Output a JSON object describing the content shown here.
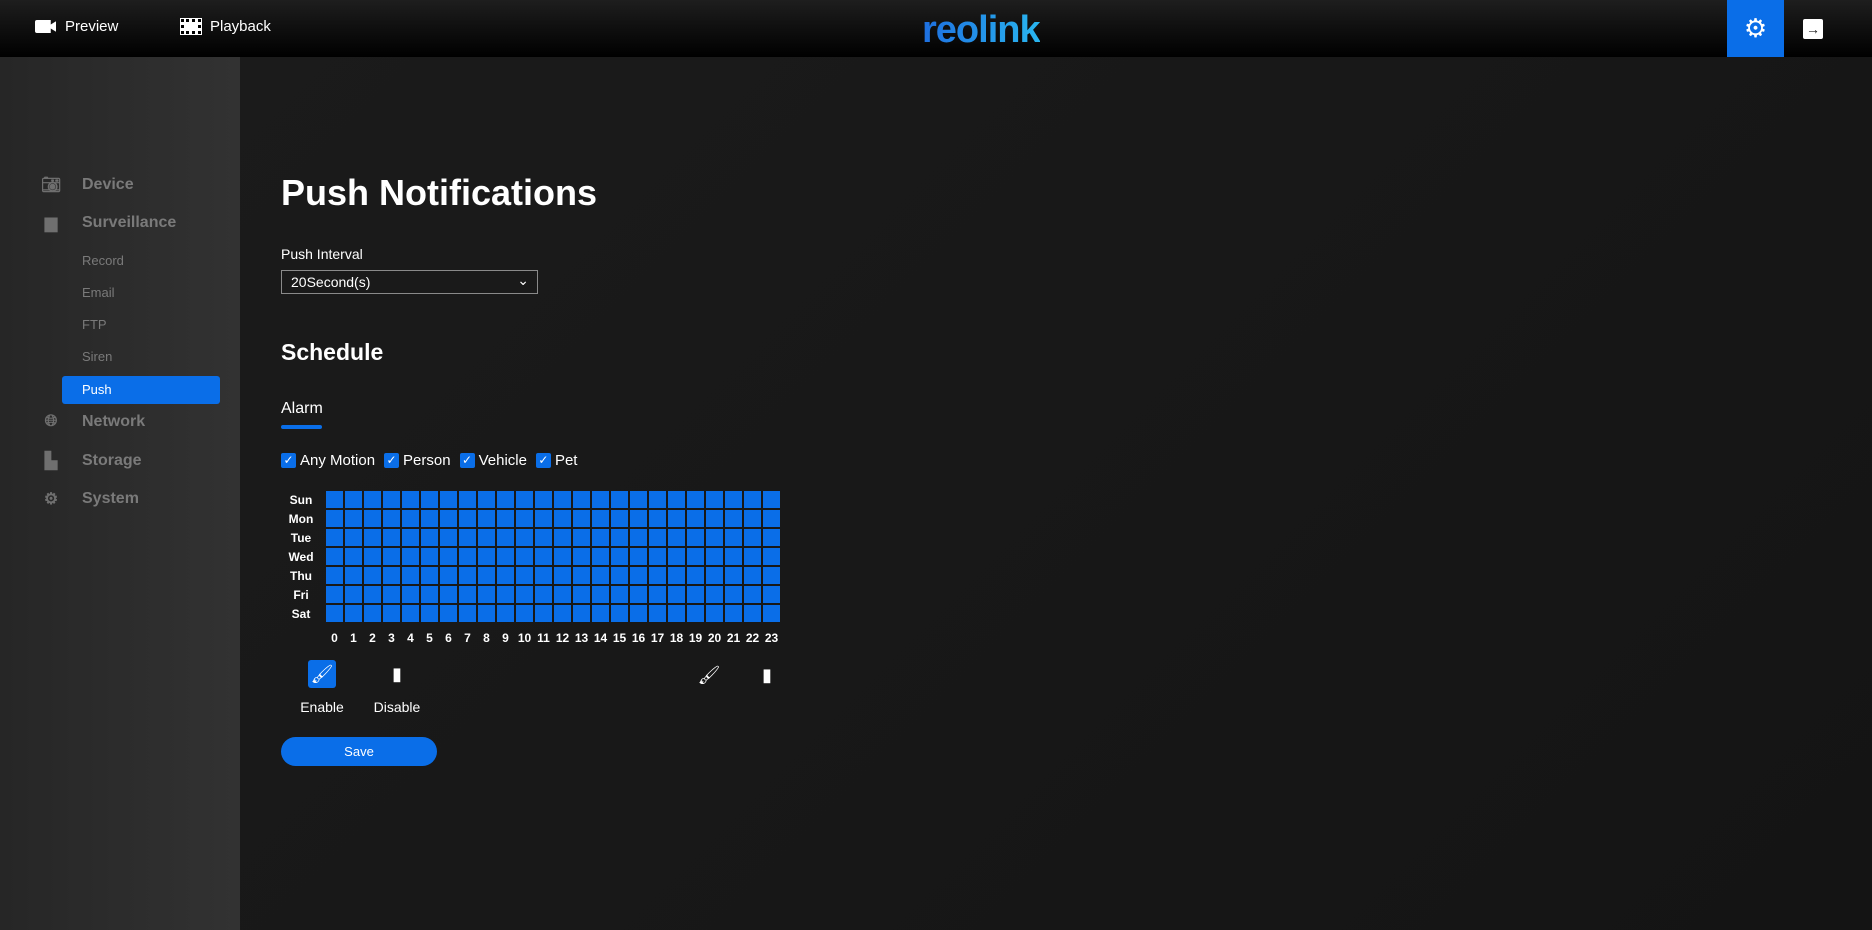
{
  "header": {
    "preview_label": "Preview",
    "playback_label": "Playback",
    "logo": "reolink",
    "accent": "#0a6ee8"
  },
  "sidebar": {
    "device": "Device",
    "surveillance": "Surveillance",
    "sub_items": [
      "Record",
      "Email",
      "FTP",
      "Siren",
      "Push"
    ],
    "active": "Push",
    "network": "Network",
    "storage": "Storage",
    "system": "System"
  },
  "main": {
    "title": "Push Notifications",
    "push_interval_label": "Push Interval",
    "push_interval_value": "20Second(s)",
    "schedule_title": "Schedule",
    "tab": "Alarm",
    "checkboxes": [
      {
        "label": "Any Motion",
        "checked": true
      },
      {
        "label": "Person",
        "checked": true
      },
      {
        "label": "Vehicle",
        "checked": true
      },
      {
        "label": "Pet",
        "checked": true
      }
    ],
    "days": [
      "Sun",
      "Mon",
      "Tue",
      "Wed",
      "Thu",
      "Fri",
      "Sat"
    ],
    "hours": [
      "0",
      "1",
      "2",
      "3",
      "4",
      "5",
      "6",
      "7",
      "8",
      "9",
      "10",
      "11",
      "12",
      "13",
      "14",
      "15",
      "16",
      "17",
      "18",
      "19",
      "20",
      "21",
      "22",
      "23"
    ],
    "schedule_enabled_all_hours": true,
    "enable_label": "Enable",
    "disable_label": "Disable",
    "save_label": "Save"
  }
}
